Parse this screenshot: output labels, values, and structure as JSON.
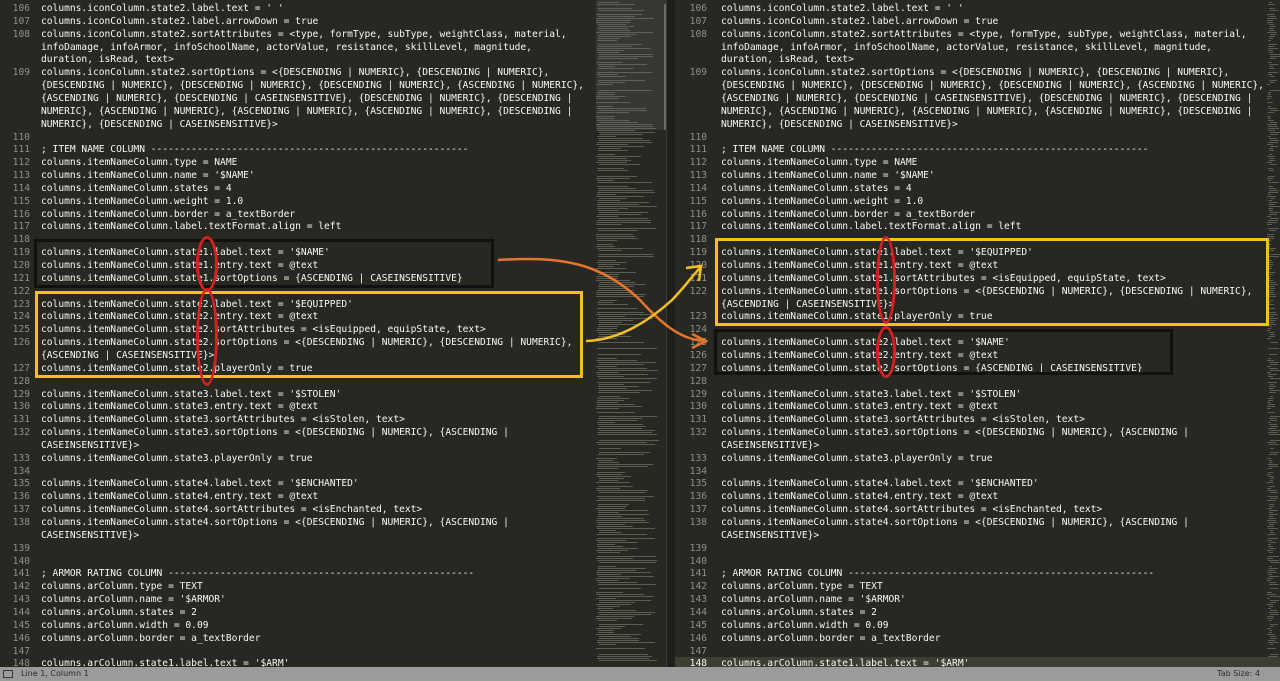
{
  "left_pane": {
    "lines": [
      {
        "n": "106",
        "t": "columns.iconColumn.state2.label.text = ' '"
      },
      {
        "n": "107",
        "t": "columns.iconColumn.state2.label.arrowDown = true"
      },
      {
        "n": "108",
        "t": "columns.iconColumn.state2.sortAttributes = <type, formType, subType, weightClass, material,"
      },
      {
        "n": "",
        "t": "infoDamage, infoArmor, infoSchoolName, actorValue, resistance, skillLevel, magnitude,"
      },
      {
        "n": "",
        "t": "duration, isRead, text>"
      },
      {
        "n": "109",
        "t": "columns.iconColumn.state2.sortOptions = <{DESCENDING | NUMERIC}, {DESCENDING | NUMERIC},"
      },
      {
        "n": "",
        "t": "{DESCENDING | NUMERIC}, {DESCENDING | NUMERIC}, {DESCENDING | NUMERIC}, {ASCENDING | NUMERIC},"
      },
      {
        "n": "",
        "t": "{ASCENDING | NUMERIC}, {DESCENDING | CASEINSENSITIVE}, {DESCENDING | NUMERIC}, {DESCENDING |"
      },
      {
        "n": "",
        "t": "NUMERIC}, {ASCENDING | NUMERIC}, {ASCENDING | NUMERIC}, {ASCENDING | NUMERIC}, {DESCENDING |"
      },
      {
        "n": "",
        "t": "NUMERIC}, {DESCENDING | CASEINSENSITIVE}>"
      },
      {
        "n": "110",
        "t": ""
      },
      {
        "n": "111",
        "t": "; ITEM NAME COLUMN -------------------------------------------------------"
      },
      {
        "n": "112",
        "t": "columns.itemNameColumn.type = NAME"
      },
      {
        "n": "113",
        "t": "columns.itemNameColumn.name = '$NAME'"
      },
      {
        "n": "114",
        "t": "columns.itemNameColumn.states = 4"
      },
      {
        "n": "115",
        "t": "columns.itemNameColumn.weight = 1.0"
      },
      {
        "n": "116",
        "t": "columns.itemNameColumn.border = a_textBorder"
      },
      {
        "n": "117",
        "t": "columns.itemNameColumn.label.textFormat.align = left"
      },
      {
        "n": "118",
        "t": ""
      },
      {
        "n": "119",
        "t": "columns.itemNameColumn.state1.label.text = '$NAME'"
      },
      {
        "n": "120",
        "t": "columns.itemNameColumn.state1.entry.text = @text"
      },
      {
        "n": "121",
        "t": "columns.itemNameColumn.state1.sortOptions = {ASCENDING | CASEINSENSITIVE}"
      },
      {
        "n": "122",
        "t": ""
      },
      {
        "n": "123",
        "t": "columns.itemNameColumn.state2.label.text = '$EQUIPPED'"
      },
      {
        "n": "124",
        "t": "columns.itemNameColumn.state2.entry.text = @text"
      },
      {
        "n": "125",
        "t": "columns.itemNameColumn.state2.sortAttributes = <isEquipped, equipState, text>"
      },
      {
        "n": "126",
        "t": "columns.itemNameColumn.state2.sortOptions = <{DESCENDING | NUMERIC}, {DESCENDING | NUMERIC},"
      },
      {
        "n": "",
        "t": "{ASCENDING | CASEINSENSITIVE}>"
      },
      {
        "n": "127",
        "t": "columns.itemNameColumn.state2.playerOnly = true"
      },
      {
        "n": "128",
        "t": ""
      },
      {
        "n": "129",
        "t": "columns.itemNameColumn.state3.label.text = '$STOLEN'"
      },
      {
        "n": "130",
        "t": "columns.itemNameColumn.state3.entry.text = @text"
      },
      {
        "n": "131",
        "t": "columns.itemNameColumn.state3.sortAttributes = <isStolen, text>"
      },
      {
        "n": "132",
        "t": "columns.itemNameColumn.state3.sortOptions = <{DESCENDING | NUMERIC}, {ASCENDING |"
      },
      {
        "n": "",
        "t": "CASEINSENSITIVE}>"
      },
      {
        "n": "133",
        "t": "columns.itemNameColumn.state3.playerOnly = true"
      },
      {
        "n": "134",
        "t": ""
      },
      {
        "n": "135",
        "t": "columns.itemNameColumn.state4.label.text = '$ENCHANTED'"
      },
      {
        "n": "136",
        "t": "columns.itemNameColumn.state4.entry.text = @text"
      },
      {
        "n": "137",
        "t": "columns.itemNameColumn.state4.sortAttributes = <isEnchanted, text>"
      },
      {
        "n": "138",
        "t": "columns.itemNameColumn.state4.sortOptions = <{DESCENDING | NUMERIC}, {ASCENDING |"
      },
      {
        "n": "",
        "t": "CASEINSENSITIVE}>"
      },
      {
        "n": "139",
        "t": ""
      },
      {
        "n": "140",
        "t": ""
      },
      {
        "n": "141",
        "t": "; ARMOR RATING COLUMN -----------------------------------------------------"
      },
      {
        "n": "142",
        "t": "columns.arColumn.type = TEXT"
      },
      {
        "n": "143",
        "t": "columns.arColumn.name = '$ARMOR'"
      },
      {
        "n": "144",
        "t": "columns.arColumn.states = 2"
      },
      {
        "n": "145",
        "t": "columns.arColumn.width = 0.09"
      },
      {
        "n": "146",
        "t": "columns.arColumn.border = a_textBorder"
      },
      {
        "n": "147",
        "t": ""
      },
      {
        "n": "148",
        "t": "columns.arColumn.state1.label.text = '$ARM'"
      }
    ]
  },
  "right_pane": {
    "lines": [
      {
        "n": "106",
        "t": "columns.iconColumn.state2.label.text = ' '"
      },
      {
        "n": "107",
        "t": "columns.iconColumn.state2.label.arrowDown = true"
      },
      {
        "n": "108",
        "t": "columns.iconColumn.state2.sortAttributes = <type, formType, subType, weightClass, material,"
      },
      {
        "n": "",
        "t": "infoDamage, infoArmor, infoSchoolName, actorValue, resistance, skillLevel, magnitude,"
      },
      {
        "n": "",
        "t": "duration, isRead, text>"
      },
      {
        "n": "109",
        "t": "columns.iconColumn.state2.sortOptions = <{DESCENDING | NUMERIC}, {DESCENDING | NUMERIC},"
      },
      {
        "n": "",
        "t": "{DESCENDING | NUMERIC}, {DESCENDING | NUMERIC}, {DESCENDING | NUMERIC}, {ASCENDING | NUMERIC},"
      },
      {
        "n": "",
        "t": "{ASCENDING | NUMERIC}, {DESCENDING | CASEINSENSITIVE}, {DESCENDING | NUMERIC}, {DESCENDING |"
      },
      {
        "n": "",
        "t": "NUMERIC}, {ASCENDING | NUMERIC}, {ASCENDING | NUMERIC}, {ASCENDING | NUMERIC}, {DESCENDING |"
      },
      {
        "n": "",
        "t": "NUMERIC}, {DESCENDING | CASEINSENSITIVE}>"
      },
      {
        "n": "110",
        "t": ""
      },
      {
        "n": "111",
        "t": "; ITEM NAME COLUMN -------------------------------------------------------"
      },
      {
        "n": "112",
        "t": "columns.itemNameColumn.type = NAME"
      },
      {
        "n": "113",
        "t": "columns.itemNameColumn.name = '$NAME'"
      },
      {
        "n": "114",
        "t": "columns.itemNameColumn.states = 4"
      },
      {
        "n": "115",
        "t": "columns.itemNameColumn.weight = 1.0"
      },
      {
        "n": "116",
        "t": "columns.itemNameColumn.border = a_textBorder"
      },
      {
        "n": "117",
        "t": "columns.itemNameColumn.label.textFormat.align = left"
      },
      {
        "n": "118",
        "t": ""
      },
      {
        "n": "119",
        "t": "columns.itemNameColumn.state1.label.text = '$EQUIPPED'"
      },
      {
        "n": "120",
        "t": "columns.itemNameColumn.state1.entry.text = @text"
      },
      {
        "n": "121",
        "t": "columns.itemNameColumn.state1.sortAttributes = <isEquipped, equipState, text>"
      },
      {
        "n": "122",
        "t": "columns.itemNameColumn.state1.sortOptions = <{DESCENDING | NUMERIC}, {DESCENDING | NUMERIC},"
      },
      {
        "n": "",
        "t": "{ASCENDING | CASEINSENSITIVE}>"
      },
      {
        "n": "123",
        "t": "columns.itemNameColumn.state1.playerOnly = true"
      },
      {
        "n": "124",
        "t": ""
      },
      {
        "n": "125",
        "t": "columns.itemNameColumn.state2.label.text = '$NAME'"
      },
      {
        "n": "126",
        "t": "columns.itemNameColumn.state2.entry.text = @text"
      },
      {
        "n": "127",
        "t": "columns.itemNameColumn.state2.sortOptions = {ASCENDING | CASEINSENSITIVE}"
      },
      {
        "n": "128",
        "t": ""
      },
      {
        "n": "129",
        "t": "columns.itemNameColumn.state3.label.text = '$STOLEN'"
      },
      {
        "n": "130",
        "t": "columns.itemNameColumn.state3.entry.text = @text"
      },
      {
        "n": "131",
        "t": "columns.itemNameColumn.state3.sortAttributes = <isStolen, text>"
      },
      {
        "n": "132",
        "t": "columns.itemNameColumn.state3.sortOptions = <{DESCENDING | NUMERIC}, {ASCENDING |"
      },
      {
        "n": "",
        "t": "CASEINSENSITIVE}>"
      },
      {
        "n": "133",
        "t": "columns.itemNameColumn.state3.playerOnly = true"
      },
      {
        "n": "134",
        "t": ""
      },
      {
        "n": "135",
        "t": "columns.itemNameColumn.state4.label.text = '$ENCHANTED'"
      },
      {
        "n": "136",
        "t": "columns.itemNameColumn.state4.entry.text = @text"
      },
      {
        "n": "137",
        "t": "columns.itemNameColumn.state4.sortAttributes = <isEnchanted, text>"
      },
      {
        "n": "138",
        "t": "columns.itemNameColumn.state4.sortOptions = <{DESCENDING | NUMERIC}, {ASCENDING |"
      },
      {
        "n": "",
        "t": "CASEINSENSITIVE}>"
      },
      {
        "n": "139",
        "t": ""
      },
      {
        "n": "140",
        "t": ""
      },
      {
        "n": "141",
        "t": "; ARMOR RATING COLUMN -----------------------------------------------------"
      },
      {
        "n": "142",
        "t": "columns.arColumn.type = TEXT"
      },
      {
        "n": "143",
        "t": "columns.arColumn.name = '$ARMOR'"
      },
      {
        "n": "144",
        "t": "columns.arColumn.states = 2"
      },
      {
        "n": "145",
        "t": "columns.arColumn.width = 0.09"
      },
      {
        "n": "146",
        "t": "columns.arColumn.border = a_textBorder"
      },
      {
        "n": "147",
        "t": ""
      },
      {
        "n": "148",
        "t": "columns.arColumn.state1.label.text = '$ARM'"
      }
    ]
  },
  "status_bar": {
    "position": "Line 1, Column 1",
    "tab_size": "Tab Size: 4"
  },
  "colors": {
    "editor_bg": "#272822",
    "annotation_black": "#111111",
    "annotation_yellow": "#f4c11a",
    "annotation_red": "#d92020",
    "annotation_orange": "#e8742a"
  }
}
